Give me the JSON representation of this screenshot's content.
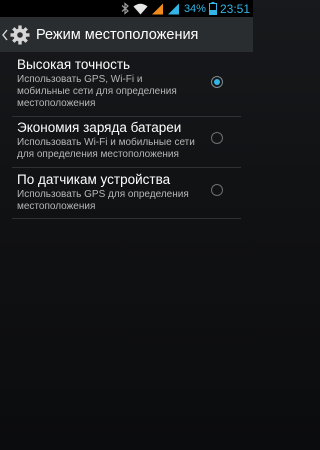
{
  "status_bar": {
    "battery_percent": "34%",
    "time": "23:51",
    "icons": [
      "bluetooth-icon",
      "wifi-icon",
      "signal-icon",
      "signal-icon",
      "battery-icon"
    ],
    "accent_color": "#33b5e5"
  },
  "action_bar": {
    "title": "Режим местоположения",
    "icon": "gear-icon"
  },
  "options": [
    {
      "label": "Высокая точность",
      "summary": "Использовать GPS, Wi-Fi и мобильные сети для определения местоположения",
      "checked": true
    },
    {
      "label": "Экономия заряда батареи",
      "summary": "Использовать Wi-Fi и мобильные сети для определения местоположения",
      "checked": false
    },
    {
      "label": "По датчикам устройства",
      "summary": "Использовать GPS для определения местоположения",
      "checked": false
    }
  ]
}
